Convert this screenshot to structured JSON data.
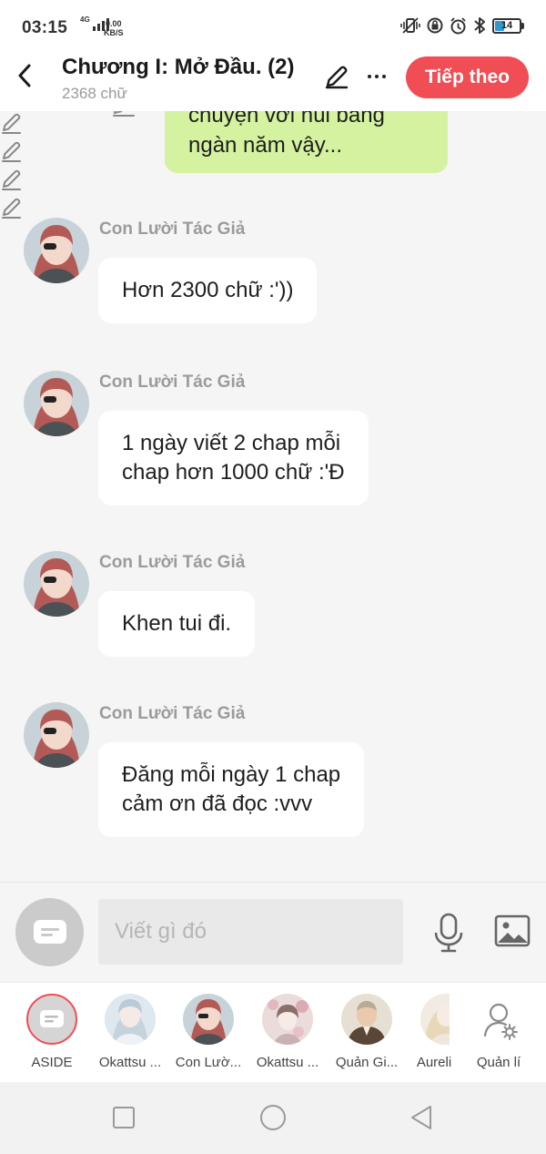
{
  "status_bar": {
    "time": "03:15",
    "network": "4G",
    "speed_value": "0.00",
    "speed_unit": "KB/S",
    "battery": "14"
  },
  "header": {
    "title": "Chương I: Mở Đầu. (2)",
    "subtitle": "2368 chữ",
    "next_label": "Tiếp theo"
  },
  "chat": {
    "partial_message": "chuyện với núi băng\nngàn năm vậy...",
    "messages": [
      {
        "author": "Con Lười Tác Giả",
        "text": "Hơn 2300 chữ :'))"
      },
      {
        "author": "Con Lười Tác Giả",
        "text": "1 ngày viết 2 chap mỗi\nchap hơn 1000 chữ :'Đ"
      },
      {
        "author": "Con Lười Tác Giả",
        "text": "Khen tui đi."
      },
      {
        "author": "Con Lười Tác Giả",
        "text": "Đăng mỗi ngày 1 chap\ncảm ơn đã đọc :vvv"
      }
    ]
  },
  "input": {
    "placeholder": "Viết gì đó",
    "value": ""
  },
  "characters": [
    {
      "label": "ASIDE"
    },
    {
      "label": "Okattsu ..."
    },
    {
      "label": "Con Lườ..."
    },
    {
      "label": "Okattsu ..."
    },
    {
      "label": "Quản Gi..."
    },
    {
      "label": "Aureli"
    },
    {
      "label": "Quản lí"
    }
  ],
  "colors": {
    "accent": "#f04d55",
    "own_bubble": "#d4f2a0",
    "other_bubble": "#ffffff",
    "background": "#f5f5f5"
  }
}
